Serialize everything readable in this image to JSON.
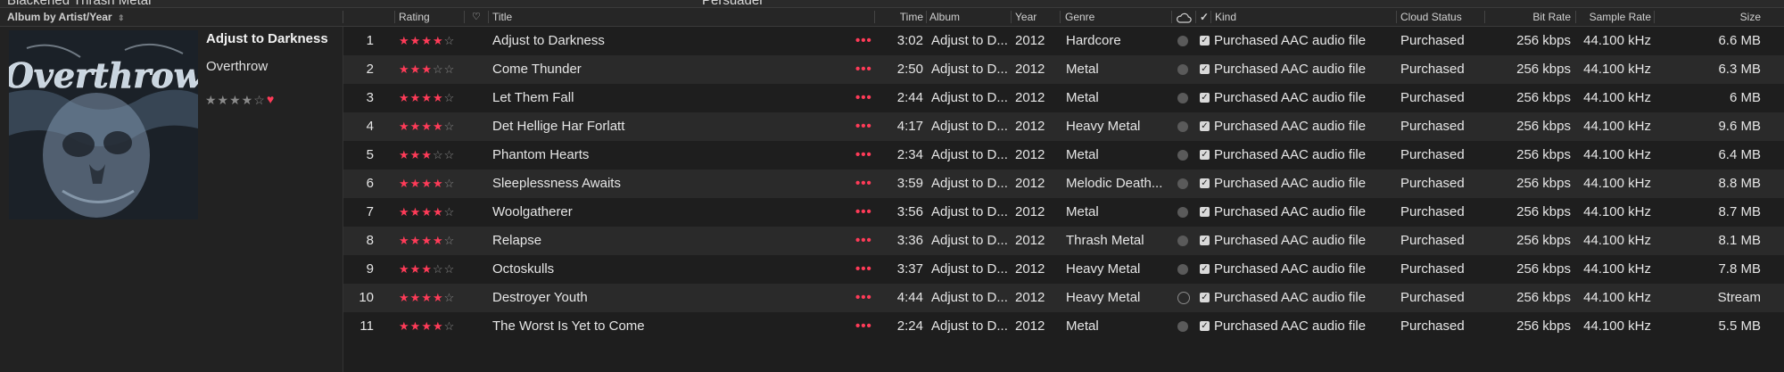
{
  "top_strip": {
    "genre_text": "Blackened Thrash Metal",
    "artist_text": "Persuader"
  },
  "header": {
    "sort_label": "Album by Artist/Year",
    "rating": "Rating",
    "title": "Title",
    "time": "Time",
    "album": "Album",
    "year": "Year",
    "genre": "Genre",
    "kind": "Kind",
    "cloud_status": "Cloud Status",
    "bit_rate": "Bit Rate",
    "sample_rate": "Sample Rate",
    "size": "Size"
  },
  "album": {
    "title": "Adjust to Darkness",
    "artist": "Overthrow",
    "rating_stars": "★★★★☆",
    "loved": "♥",
    "art_logo_text": "Overthrow"
  },
  "colors": {
    "accent": "#ff3b58",
    "row_alt": "#2a2a2a",
    "background": "#1e1e1e"
  },
  "tracks": [
    {
      "num": "1",
      "rating": 4,
      "title": "Adjust to Darkness",
      "time": "3:02",
      "album": "Adjust to D...",
      "year": "2012",
      "genre": "Hardcore",
      "cloud": "downloaded",
      "kind": "Purchased AAC audio file",
      "status": "Purchased",
      "bitrate": "256 kbps",
      "sample": "44.100 kHz",
      "size": "6.6 MB"
    },
    {
      "num": "2",
      "rating": 3,
      "title": "Come Thunder",
      "time": "2:50",
      "album": "Adjust to D...",
      "year": "2012",
      "genre": "Metal",
      "cloud": "downloaded",
      "kind": "Purchased AAC audio file",
      "status": "Purchased",
      "bitrate": "256 kbps",
      "sample": "44.100 kHz",
      "size": "6.3 MB"
    },
    {
      "num": "3",
      "rating": 4,
      "title": "Let Them Fall",
      "time": "2:44",
      "album": "Adjust to D...",
      "year": "2012",
      "genre": "Metal",
      "cloud": "downloaded",
      "kind": "Purchased AAC audio file",
      "status": "Purchased",
      "bitrate": "256 kbps",
      "sample": "44.100 kHz",
      "size": "6 MB"
    },
    {
      "num": "4",
      "rating": 4,
      "title": "Det Hellige Har Forlatt",
      "time": "4:17",
      "album": "Adjust to D...",
      "year": "2012",
      "genre": "Heavy Metal",
      "cloud": "downloaded",
      "kind": "Purchased AAC audio file",
      "status": "Purchased",
      "bitrate": "256 kbps",
      "sample": "44.100 kHz",
      "size": "9.6 MB"
    },
    {
      "num": "5",
      "rating": 3,
      "title": "Phantom Hearts",
      "time": "2:34",
      "album": "Adjust to D...",
      "year": "2012",
      "genre": "Metal",
      "cloud": "downloaded",
      "kind": "Purchased AAC audio file",
      "status": "Purchased",
      "bitrate": "256 kbps",
      "sample": "44.100 kHz",
      "size": "6.4 MB"
    },
    {
      "num": "6",
      "rating": 4,
      "title": "Sleeplessness Awaits",
      "time": "3:59",
      "album": "Adjust to D...",
      "year": "2012",
      "genre": "Melodic Death...",
      "cloud": "downloaded",
      "kind": "Purchased AAC audio file",
      "status": "Purchased",
      "bitrate": "256 kbps",
      "sample": "44.100 kHz",
      "size": "8.8 MB"
    },
    {
      "num": "7",
      "rating": 4,
      "title": "Woolgatherer",
      "time": "3:56",
      "album": "Adjust to D...",
      "year": "2012",
      "genre": "Metal",
      "cloud": "downloaded",
      "kind": "Purchased AAC audio file",
      "status": "Purchased",
      "bitrate": "256 kbps",
      "sample": "44.100 kHz",
      "size": "8.7 MB"
    },
    {
      "num": "8",
      "rating": 4,
      "title": "Relapse",
      "time": "3:36",
      "album": "Adjust to D...",
      "year": "2012",
      "genre": "Thrash Metal",
      "cloud": "downloaded",
      "kind": "Purchased AAC audio file",
      "status": "Purchased",
      "bitrate": "256 kbps",
      "sample": "44.100 kHz",
      "size": "8.1 MB"
    },
    {
      "num": "9",
      "rating": 3,
      "title": "Octoskulls",
      "time": "3:37",
      "album": "Adjust to D...",
      "year": "2012",
      "genre": "Heavy Metal",
      "cloud": "downloaded",
      "kind": "Purchased AAC audio file",
      "status": "Purchased",
      "bitrate": "256 kbps",
      "sample": "44.100 kHz",
      "size": "7.8 MB"
    },
    {
      "num": "10",
      "rating": 4,
      "title": "Destroyer Youth",
      "time": "4:44",
      "album": "Adjust to D...",
      "year": "2012",
      "genre": "Heavy Metal",
      "cloud": "stream",
      "kind": "Purchased AAC audio file",
      "status": "Purchased",
      "bitrate": "256 kbps",
      "sample": "44.100 kHz",
      "size": "Stream"
    },
    {
      "num": "11",
      "rating": 4,
      "title": "The Worst Is Yet to Come",
      "time": "2:24",
      "album": "Adjust to D...",
      "year": "2012",
      "genre": "Metal",
      "cloud": "downloaded",
      "kind": "Purchased AAC audio file",
      "status": "Purchased",
      "bitrate": "256 kbps",
      "sample": "44.100 kHz",
      "size": "5.5 MB"
    }
  ]
}
